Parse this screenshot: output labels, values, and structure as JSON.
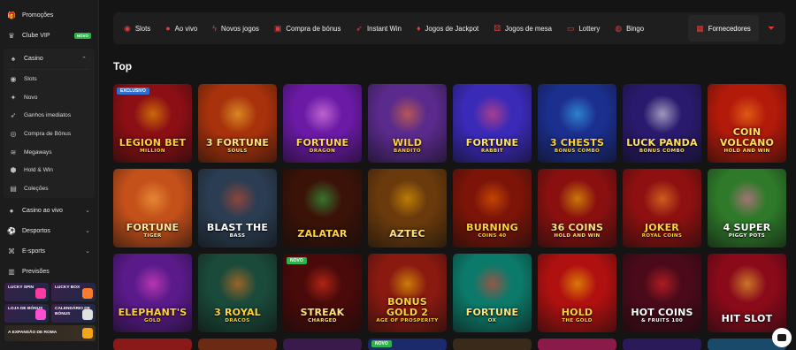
{
  "sidebar": {
    "top_items": [
      {
        "label": "Promoções",
        "icon": "gift-icon"
      },
      {
        "label": "Clube VIP",
        "icon": "crown-icon",
        "badge": "NOVO"
      }
    ],
    "casino": {
      "label": "Casino",
      "icon": "cards-icon"
    },
    "casino_sub": [
      {
        "label": "Slots",
        "icon": "slot-icon"
      },
      {
        "label": "Novo",
        "icon": "new-icon"
      },
      {
        "label": "Ganhos imediatos",
        "icon": "rocket-icon"
      },
      {
        "label": "Compra de Bônus",
        "icon": "coin-icon"
      },
      {
        "label": "Megaways",
        "icon": "megaways-icon"
      },
      {
        "label": "Hold & Win",
        "icon": "hold-icon"
      },
      {
        "label": "Coleções",
        "icon": "collection-icon"
      }
    ],
    "bottom_items": [
      {
        "label": "Casino ao vivo",
        "icon": "live-icon"
      },
      {
        "label": "Desportos",
        "icon": "ball-icon"
      },
      {
        "label": "E-sports",
        "icon": "gamepad-icon"
      },
      {
        "label": "Previsões",
        "icon": "chart-icon"
      }
    ],
    "promos": [
      {
        "label": "LUCKY SPIN"
      },
      {
        "label": "LUCKY BOX"
      },
      {
        "label": "LOJA DE BÓNUS"
      },
      {
        "label": "CALENDÁRIO DE BÓNUS"
      },
      {
        "label": "A EXPANSÃO DE ROMA"
      }
    ]
  },
  "topnav": {
    "items": [
      {
        "label": "Slots",
        "icon": "slot-icon"
      },
      {
        "label": "Ao vivo",
        "icon": "live-icon"
      },
      {
        "label": "Novos jogos",
        "icon": "lightning-icon"
      },
      {
        "label": "Compra de bónus",
        "icon": "bag-icon"
      },
      {
        "label": "Instant Win",
        "icon": "rocket-icon"
      },
      {
        "label": "Jogos de Jackpot",
        "icon": "jackpot-icon"
      },
      {
        "label": "Jogos de mesa",
        "icon": "dice-icon"
      },
      {
        "label": "Lottery",
        "icon": "ticket-icon"
      },
      {
        "label": "Bingo",
        "icon": "bingo-icon"
      }
    ],
    "providers_label": "Fornecedores",
    "filter_icon": "filter-icon"
  },
  "section_title": "Top",
  "games": [
    {
      "title": "Legion Bet",
      "sub": "MILLION",
      "tag": "EXCLUSIVO",
      "bg": "#8b0f14",
      "fg": "#ffd23a",
      "orb": "#ffb000"
    },
    {
      "title": "3 Fortune",
      "sub": "SOULS",
      "tag": "",
      "bg": "#a8320c",
      "fg": "#ffe27a",
      "orb": "#ffcc33"
    },
    {
      "title": "Fortune",
      "sub": "DRAGON",
      "tag": "",
      "bg": "#6b1aa6",
      "fg": "#ffd54a",
      "orb": "#ff9ff0"
    },
    {
      "title": "Wild",
      "sub": "BANDITO",
      "tag": "",
      "bg": "#5a2a8c",
      "fg": "#ffcf3d",
      "orb": "#ff7a2a"
    },
    {
      "title": "Fortune",
      "sub": "RABBIT",
      "tag": "",
      "bg": "#3a2ab8",
      "fg": "#ffe15a",
      "orb": "#ff4d6d"
    },
    {
      "title": "3 Chests",
      "sub": "BONUS COMBO",
      "tag": "",
      "bg": "#1b2f8f",
      "fg": "#ffd23a",
      "orb": "#3cc3ff"
    },
    {
      "title": "Luck Panda",
      "sub": "BONUS COMBO",
      "tag": "",
      "bg": "#2a1a6e",
      "fg": "#ffe15a",
      "orb": "#ffffff"
    },
    {
      "title": "Coin Volcano",
      "sub": "HOLD AND WIN",
      "tag": "",
      "bg": "#b31a0a",
      "fg": "#ffe15a",
      "orb": "#ff8c1a"
    },
    {
      "title": "Fortune",
      "sub": "TIGER",
      "tag": "",
      "bg": "#c4501a",
      "fg": "#ffe7a0",
      "orb": "#ffb347"
    },
    {
      "title": "Blast the",
      "sub": "BASS",
      "tag": "",
      "bg": "#2b3d52",
      "fg": "#ffffff",
      "orb": "#d94b2b"
    },
    {
      "title": "Zalatar",
      "sub": "",
      "tag": "",
      "bg": "#3a1208",
      "fg": "#ffd23a",
      "orb": "#37c249"
    },
    {
      "title": "Aztec",
      "sub": "",
      "tag": "",
      "bg": "#6a3a0c",
      "fg": "#ffe27a",
      "orb": "#ffb000"
    },
    {
      "title": "Burning",
      "sub": "COINS 40",
      "tag": "",
      "bg": "#7c1408",
      "fg": "#ffd23a",
      "orb": "#ff6a00"
    },
    {
      "title": "36 Coins",
      "sub": "HOLD AND WIN",
      "tag": "",
      "bg": "#8a1010",
      "fg": "#ffe27a",
      "orb": "#ffcc00"
    },
    {
      "title": "Joker",
      "sub": "ROYAL COINS",
      "tag": "",
      "bg": "#8e1010",
      "fg": "#ffd23a",
      "orb": "#ff9c2a"
    },
    {
      "title": "4 Super",
      "sub": "PIGGY POTS",
      "tag": "",
      "bg": "#2e7a2a",
      "fg": "#ffffff",
      "orb": "#ff6fae"
    },
    {
      "title": "Elephant's",
      "sub": "GOLD",
      "tag": "",
      "bg": "#5a1a8a",
      "fg": "#ffd23a",
      "orb": "#ff4dd2"
    },
    {
      "title": "3 Royal",
      "sub": "DRACOS",
      "tag": "",
      "bg": "#1a4a3a",
      "fg": "#ffd23a",
      "orb": "#ff7a1a"
    },
    {
      "title": "Streak",
      "sub": "CHARGED",
      "tag": "NOVO",
      "bg": "#4a0a0a",
      "fg": "#ffe27a",
      "orb": "#ff3a1a"
    },
    {
      "title": "Bonus Gold 2",
      "sub": "AGE OF PROSPERITY",
      "tag": "",
      "bg": "#8a1a10",
      "fg": "#ffd23a",
      "orb": "#ffcc00"
    },
    {
      "title": "Fortune",
      "sub": "OX",
      "tag": "",
      "bg": "#0c7a6a",
      "fg": "#ffe27a",
      "orb": "#ff3a2a"
    },
    {
      "title": "Hold",
      "sub": "THE GOLD",
      "tag": "",
      "bg": "#b01010",
      "fg": "#ffd23a",
      "orb": "#ffcc00"
    },
    {
      "title": "Hot Coins",
      "sub": "& FRUITS 100",
      "tag": "",
      "bg": "#4a0a1a",
      "fg": "#ffffff",
      "orb": "#ff2a2a"
    },
    {
      "title": "Hit Slot",
      "sub": "",
      "tag": "",
      "bg": "#8a0a1a",
      "fg": "#ffffff",
      "orb": "#ffcc33"
    }
  ],
  "row4": [
    {
      "bg": "#8a1a1a",
      "tag": ""
    },
    {
      "bg": "#6a2a14",
      "tag": ""
    },
    {
      "bg": "#3a1a4a",
      "tag": ""
    },
    {
      "bg": "#1a2a6a",
      "tag": "NOVO"
    },
    {
      "bg": "#3a2a1a",
      "tag": ""
    },
    {
      "bg": "#8a1a4a",
      "tag": ""
    },
    {
      "bg": "#2a1a5a",
      "tag": ""
    },
    {
      "bg": "#1a4a6a",
      "tag": ""
    }
  ],
  "colors": {
    "accent": "#e53a3a",
    "new_badge": "#2fb24c",
    "exclusive_badge": "#2c6fd1"
  },
  "chat_icon": "chat-icon"
}
